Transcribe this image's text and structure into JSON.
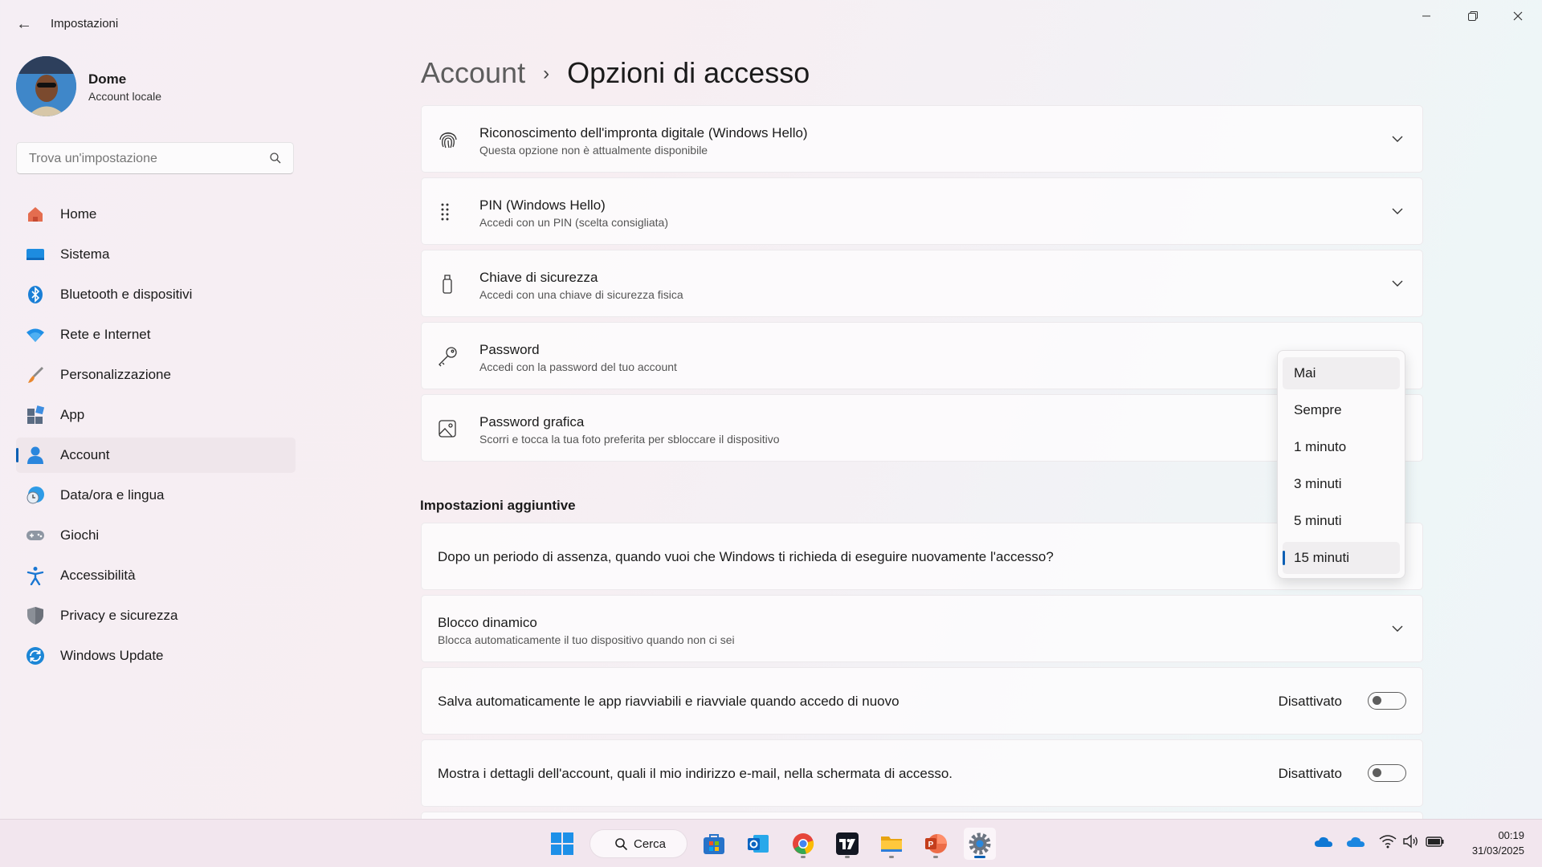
{
  "window": {
    "title": "Impostazioni",
    "back_glyph": "←"
  },
  "profile": {
    "name": "Dome",
    "account_type": "Account locale"
  },
  "search": {
    "placeholder": "Trova un'impostazione"
  },
  "sidebar": {
    "items": [
      {
        "label": "Home",
        "icon": "home-icon"
      },
      {
        "label": "Sistema",
        "icon": "system-icon"
      },
      {
        "label": "Bluetooth e dispositivi",
        "icon": "bluetooth-icon"
      },
      {
        "label": "Rete e Internet",
        "icon": "wifi-icon"
      },
      {
        "label": "Personalizzazione",
        "icon": "brush-icon"
      },
      {
        "label": "App",
        "icon": "apps-icon"
      },
      {
        "label": "Account",
        "icon": "account-icon",
        "active": true
      },
      {
        "label": "Data/ora e lingua",
        "icon": "clock-globe-icon"
      },
      {
        "label": "Giochi",
        "icon": "gamepad-icon"
      },
      {
        "label": "Accessibilità",
        "icon": "accessibility-icon"
      },
      {
        "label": "Privacy e sicurezza",
        "icon": "shield-icon"
      },
      {
        "label": "Windows Update",
        "icon": "update-icon"
      }
    ]
  },
  "breadcrumb": {
    "parent": "Account",
    "separator": "›",
    "current": "Opzioni di accesso"
  },
  "sign_in_options": [
    {
      "title": "Riconoscimento dell'impronta digitale (Windows Hello)",
      "subtitle": "Questa opzione non è attualmente disponibile",
      "icon": "fingerprint-icon"
    },
    {
      "title": "PIN (Windows Hello)",
      "subtitle": "Accedi con un PIN (scelta consigliata)",
      "icon": "pin-keypad-icon"
    },
    {
      "title": "Chiave di sicurezza",
      "subtitle": "Accedi con una chiave di sicurezza fisica",
      "icon": "usb-key-icon"
    },
    {
      "title": "Password",
      "subtitle": "Accedi con la password del tuo account",
      "icon": "key-icon"
    },
    {
      "title": "Password grafica",
      "subtitle": "Scorri e tocca la tua foto preferita per sbloccare il dispositivo",
      "icon": "picture-icon"
    }
  ],
  "additional": {
    "section_title": "Impostazioni aggiuntive",
    "reauth_question": "Dopo un periodo di assenza, quando vuoi che Windows ti richieda di eseguire nuovamente l'accesso?",
    "dynamic_lock_title": "Blocco dinamico",
    "dynamic_lock_subtitle": "Blocca automaticamente il tuo dispositivo quando non ci sei",
    "restart_apps_label": "Salva automaticamente le app riavviabili e riavviale quando accedo di nuovo",
    "restart_apps_state": "Disattivato",
    "show_details_label": "Mostra i dettagli dell'account, quali il mio indirizzo e-mail, nella schermata di accesso.",
    "show_details_state": "Disattivato"
  },
  "reauth_dropdown": {
    "options": [
      "Mai",
      "Sempre",
      "1 minuto",
      "3 minuti",
      "5 minuti",
      "15 minuti"
    ],
    "selected": "15 minuti",
    "hovered": "Mai"
  },
  "taskbar": {
    "search_label": "Cerca",
    "time": "00:19",
    "date": "31/03/2025"
  },
  "colors": {
    "accent": "#0a5fb4"
  }
}
